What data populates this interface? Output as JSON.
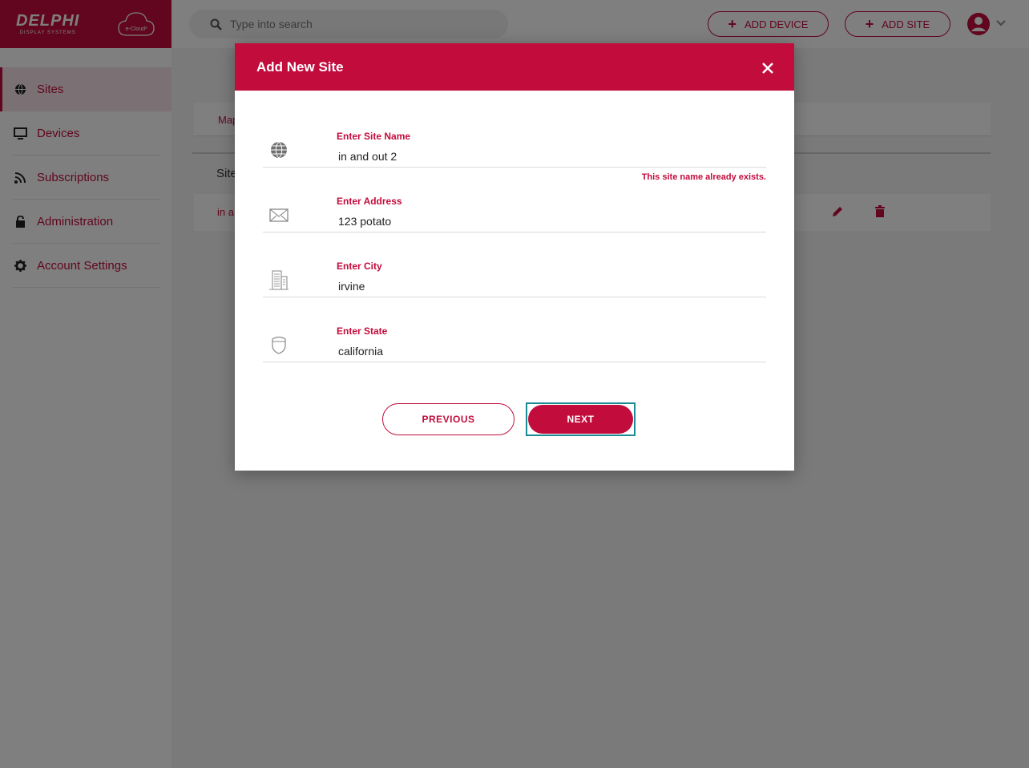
{
  "brand": {
    "name": "DELPHI",
    "subtitle": "DISPLAY SYSTEMS",
    "product": "e-Cloud²",
    "color": "#c20c3c"
  },
  "sidebar": {
    "items": [
      {
        "label": "Sites",
        "icon": "globe-icon",
        "active": true
      },
      {
        "label": "Devices",
        "icon": "monitor-icon"
      },
      {
        "label": "Subscriptions",
        "icon": "rss-icon"
      },
      {
        "label": "Administration",
        "icon": "lock-icon"
      },
      {
        "label": "Account Settings",
        "icon": "gear-icon"
      }
    ]
  },
  "header": {
    "search_placeholder": "Type into search",
    "add_device_label": "ADD DEVICE",
    "add_site_label": "ADD SITE"
  },
  "background": {
    "tab_label": "Map",
    "column_header": "Site",
    "row_label": "in a"
  },
  "modal": {
    "title": "Add New Site",
    "fields": [
      {
        "label": "Enter Site Name",
        "value": "in and out 2",
        "icon": "globe-icon"
      },
      {
        "label": "Enter Address",
        "value": "123 potato",
        "icon": "envelope-icon"
      },
      {
        "label": "Enter City",
        "value": "irvine",
        "icon": "building-icon"
      },
      {
        "label": "Enter State",
        "value": "california",
        "icon": "shield-icon"
      }
    ],
    "error": "This site name already exists.",
    "previous_label": "PREVIOUS",
    "next_label": "NEXT",
    "focus_color": "#1a8a93"
  }
}
